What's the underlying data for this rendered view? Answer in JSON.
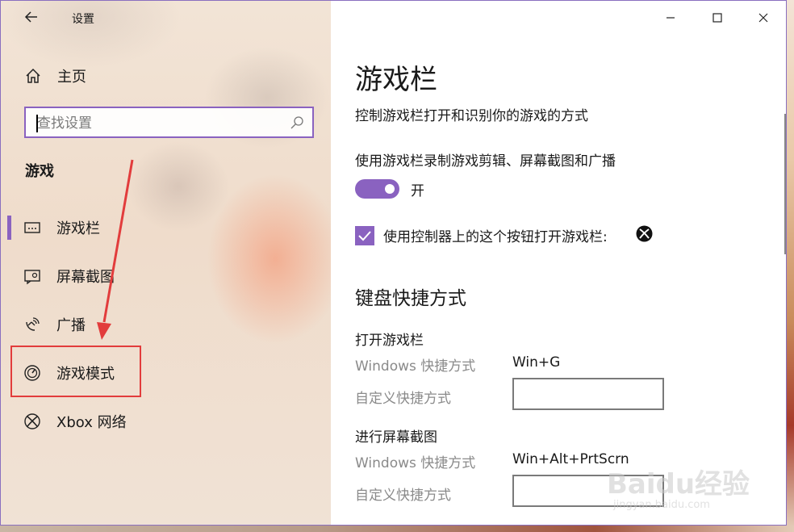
{
  "window": {
    "title": "设置"
  },
  "nav": {
    "home_label": "主页",
    "search_placeholder": "查找设置",
    "section_heading": "游戏",
    "items": [
      {
        "label": "游戏栏",
        "icon": "gamebar-icon",
        "selected": true
      },
      {
        "label": "屏幕截图",
        "icon": "screenshot-icon",
        "selected": false
      },
      {
        "label": "广播",
        "icon": "broadcast-icon",
        "selected": false
      },
      {
        "label": "游戏模式",
        "icon": "game-mode-icon",
        "selected": false
      },
      {
        "label": "Xbox 网络",
        "icon": "xbox-icon",
        "selected": false
      }
    ]
  },
  "content": {
    "title": "游戏栏",
    "description": "控制游戏栏打开和识别你的游戏的方式",
    "toggle": {
      "label": "使用游戏栏录制游戏剪辑、屏幕截图和广播",
      "state_text": "开",
      "on": true
    },
    "checkbox": {
      "label": "使用控制器上的这个按钮打开游戏栏:",
      "checked": true,
      "icon": "xbox-icon"
    },
    "shortcuts_heading": "键盘快捷方式",
    "groups": [
      {
        "title": "打开游戏栏",
        "windows_label": "Windows 快捷方式",
        "windows_value": "Win+G",
        "custom_label": "自定义快捷方式",
        "custom_value": ""
      },
      {
        "title": "进行屏幕截图",
        "windows_label": "Windows 快捷方式",
        "windows_value": "Win+Alt+PrtScrn",
        "custom_label": "自定义快捷方式",
        "custom_value": ""
      }
    ]
  },
  "watermark": {
    "brand": "Baidu经验",
    "url": "jingyan.baidu.com"
  },
  "colors": {
    "accent": "#8a62c0",
    "annotation_red": "#e23c3c"
  }
}
